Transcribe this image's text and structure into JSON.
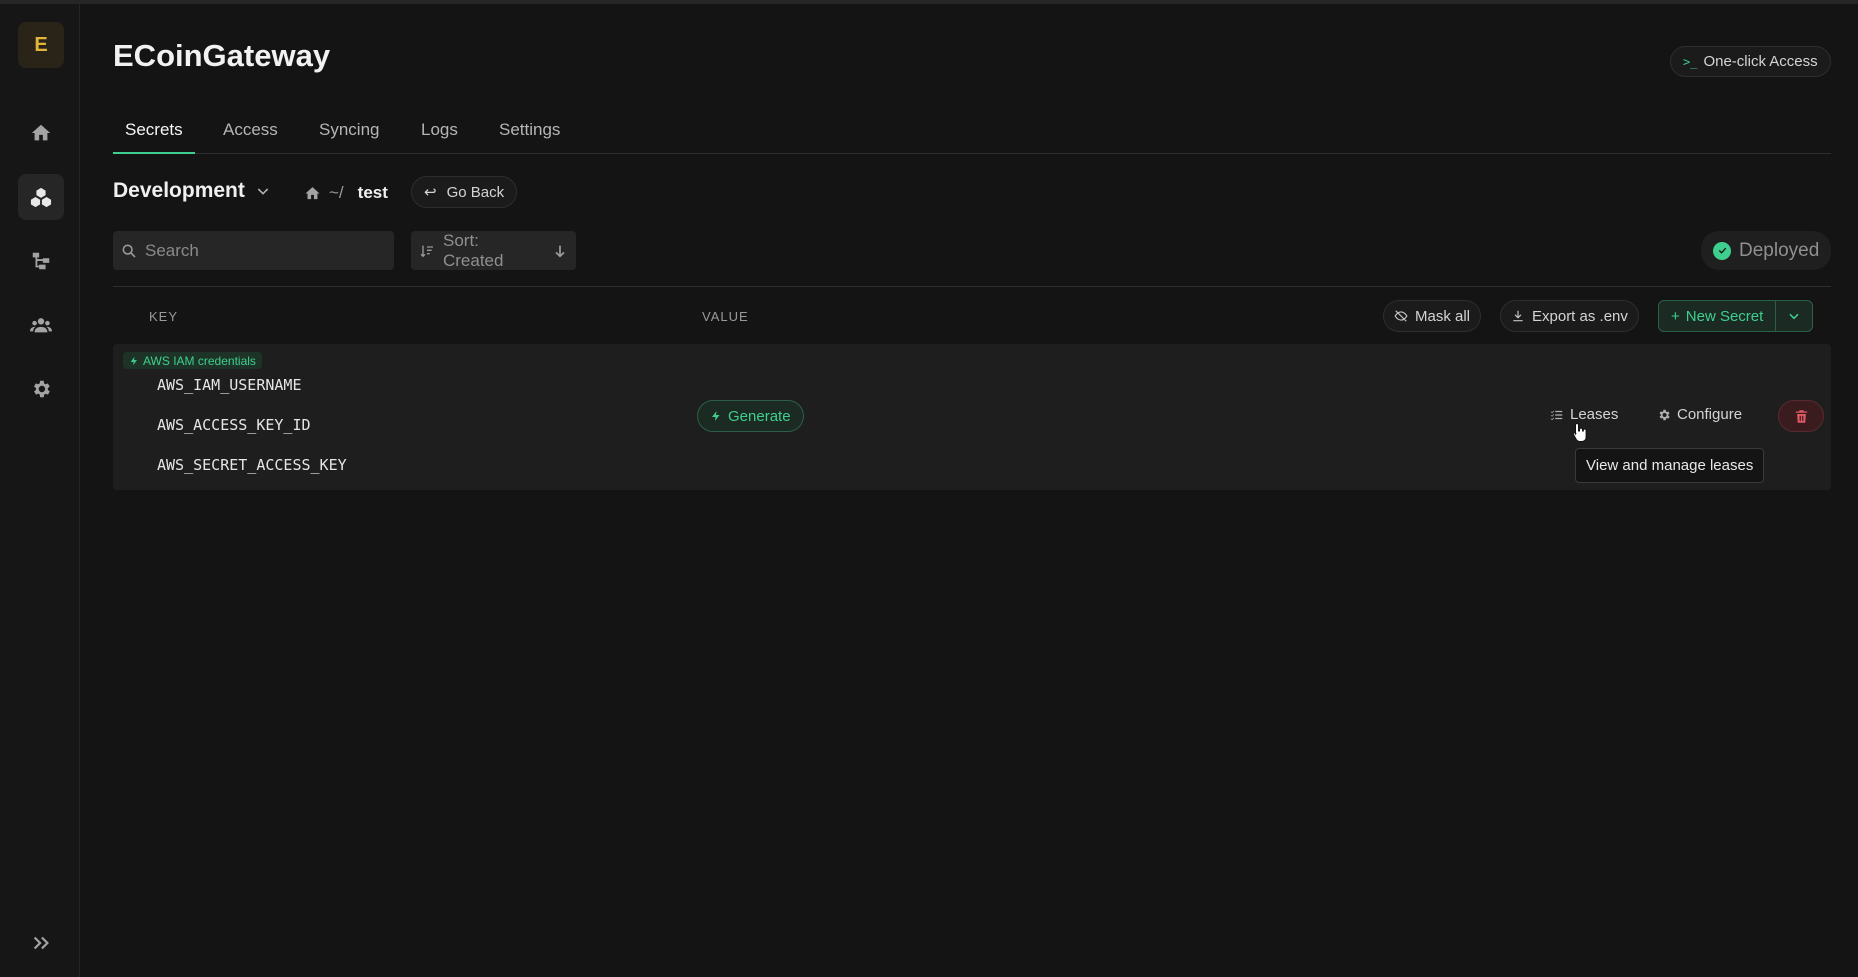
{
  "app": {
    "logo_letter": "E",
    "project_title": "ECoinGateway",
    "one_click_label": "One-click Access"
  },
  "sidebar": {
    "items": [
      "home-icon",
      "secrets-icon",
      "integrations-icon",
      "members-icon",
      "settings-icon"
    ]
  },
  "tabs": [
    {
      "label": "Secrets",
      "active": true
    },
    {
      "label": "Access"
    },
    {
      "label": "Syncing"
    },
    {
      "label": "Logs"
    },
    {
      "label": "Settings"
    }
  ],
  "environment": {
    "name": "Development"
  },
  "breadcrumb": {
    "root": "~/",
    "current": "test",
    "go_back": "Go Back"
  },
  "toolbar": {
    "search_placeholder": "Search",
    "sort_label": "Sort: Created",
    "status": "Deployed"
  },
  "table": {
    "headers": {
      "key": "KEY",
      "value": "VALUE"
    },
    "mask_all": "Mask all",
    "export_env": "Export as .env",
    "new_secret": "New Secret"
  },
  "dynamic_secret": {
    "badge": "AWS IAM credentials",
    "keys": [
      "AWS_IAM_USERNAME",
      "AWS_ACCESS_KEY_ID",
      "AWS_SECRET_ACCESS_KEY"
    ],
    "generate": "Generate",
    "leases": "Leases",
    "configure": "Configure",
    "tooltip": "View and manage leases"
  },
  "colors": {
    "accent": "#3ecf8e",
    "danger": "#e05a64",
    "logo": "#e2b43a"
  }
}
